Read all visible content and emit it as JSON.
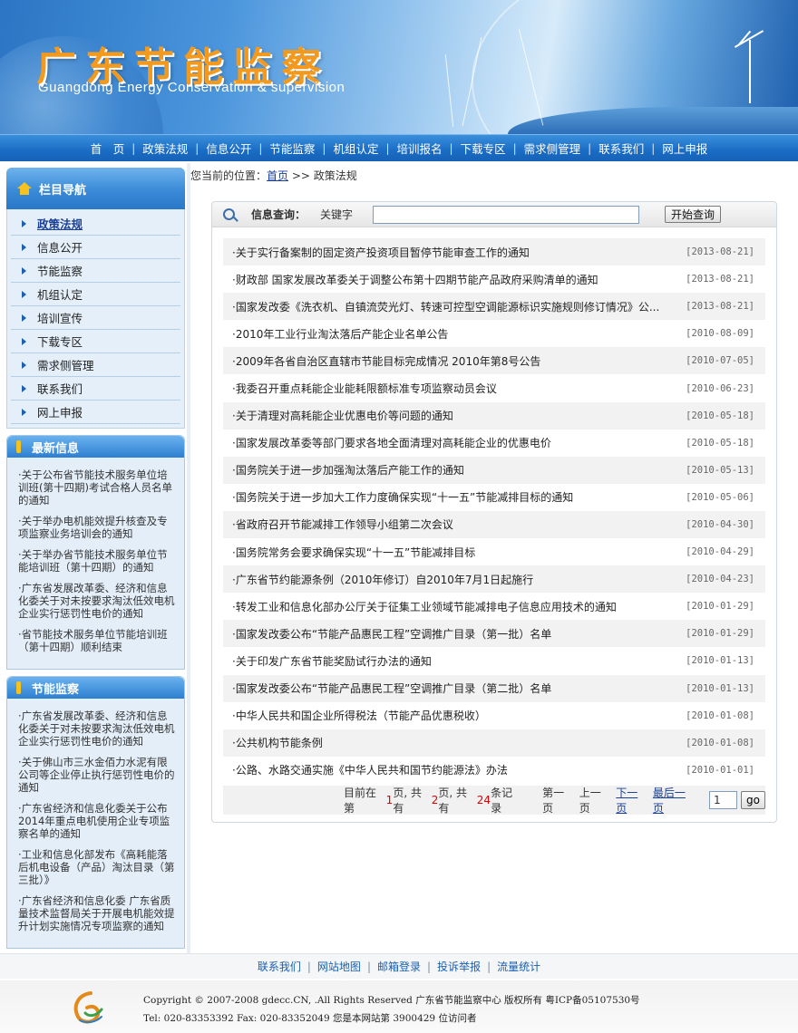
{
  "banner": {
    "title": "广东节能监察",
    "subtitle": "Guangdong Energy Conservation & supervision"
  },
  "nav": {
    "items": [
      "首　页",
      "政策法规",
      "信息公开",
      "节能监察",
      "机组认定",
      "培训报名",
      "下载专区",
      "需求侧管理",
      "联系我们",
      "网上申报"
    ]
  },
  "sidebar": {
    "title": "栏目导航",
    "items": [
      "政策法规",
      "信息公开",
      "节能监察",
      "机组认定",
      "培训宣传",
      "下载专区",
      "需求侧管理",
      "联系我们",
      "网上申报"
    ],
    "latest": {
      "title": "最新信息",
      "items": [
        "·关于公布省节能技术服务单位培训班(第十四期)考试合格人员名单的通知",
        "·关于举办电机能效提升核查及专项监察业务培训会的通知",
        "·关于举办省节能技术服务单位节能培训班（第十四期）的通知",
        "·广东省发展改革委、经济和信息化委关于对未按要求淘汰低效电机企业实行惩罚性电价的通知",
        "·省节能技术服务单位节能培训班（第十四期）顺利结束"
      ]
    },
    "supervision": {
      "title": "节能监察",
      "items": [
        "·广东省发展改革委、经济和信息化委关于对未按要求淘汰低效电机企业实行惩罚性电价的通知",
        "·关于佛山市三水金佰力水泥有限公司等企业停止执行惩罚性电价的通知",
        "·广东省经济和信息化委关于公布2014年重点电机使用企业专项监察名单的通知",
        "·工业和信息化部发布《高耗能落后机电设备（产品）淘汰目录（第三批）》",
        "·广东省经济和信息化委 广东省质量技术监督局关于开展电机能效提升计划实施情况专项监察的通知"
      ]
    }
  },
  "breadcrumb": {
    "prefix": "您当前的位置：",
    "home": "首页",
    "sep": ">>",
    "current": "政策法规"
  },
  "search": {
    "label": "信息查询：",
    "keyword_label": "关键字",
    "value": "",
    "button": "开始查询"
  },
  "articles": [
    {
      "title": "·关于实行备案制的固定资产投资项目暂停节能审查工作的通知",
      "date": "[2013-08-21]"
    },
    {
      "title": "·财政部 国家发展改革委关于调整公布第十四期节能产品政府采购清单的通知",
      "date": "[2013-08-21]"
    },
    {
      "title": "·国家发改委《洗衣机、自镇流荧光灯、转速可控型空调能源标识实施规则修订情况》公...",
      "date": "[2013-08-21]"
    },
    {
      "title": "·2010年工业行业淘汰落后产能企业名单公告",
      "date": "[2010-08-09]"
    },
    {
      "title": "·2009年各省自治区直辖市节能目标完成情况 2010年第8号公告",
      "date": "[2010-07-05]"
    },
    {
      "title": "·我委召开重点耗能企业能耗限额标准专项监察动员会议",
      "date": "[2010-06-23]"
    },
    {
      "title": "·关于清理对高耗能企业优惠电价等问题的通知",
      "date": "[2010-05-18]"
    },
    {
      "title": "·国家发展改革委等部门要求各地全面清理对高耗能企业的优惠电价",
      "date": "[2010-05-18]"
    },
    {
      "title": "·国务院关于进一步加强淘汰落后产能工作的通知",
      "date": "[2010-05-13]"
    },
    {
      "title": "·国务院关于进一步加大工作力度确保实现“十一五”节能减排目标的通知",
      "date": "[2010-05-06]"
    },
    {
      "title": "·省政府召开节能减排工作领导小组第二次会议",
      "date": "[2010-04-30]"
    },
    {
      "title": "·国务院常务会要求确保实现“十一五”节能减排目标",
      "date": "[2010-04-29]"
    },
    {
      "title": "·广东省节约能源条例（2010年修订）自2010年7月1日起施行",
      "date": "[2010-04-23]"
    },
    {
      "title": "·转发工业和信息化部办公厅关于征集工业领域节能减排电子信息应用技术的通知",
      "date": "[2010-01-29]"
    },
    {
      "title": "·国家发改委公布“节能产品惠民工程”空调推广目录（第一批）名单",
      "date": "[2010-01-29]"
    },
    {
      "title": "·关于印发广东省节能奖励试行办法的通知",
      "date": "[2010-01-13]"
    },
    {
      "title": "·国家发改委公布“节能产品惠民工程”空调推广目录（第二批）名单",
      "date": "[2010-01-13]"
    },
    {
      "title": "·中华人民共和国企业所得税法（节能产品优惠税收）",
      "date": "[2010-01-08]"
    },
    {
      "title": "·公共机构节能条例",
      "date": "[2010-01-08]"
    },
    {
      "title": "·公路、水路交通实施《中华人民共和国节约能源法》办法",
      "date": "[2010-01-01]"
    }
  ],
  "pager": {
    "t1": "目前在第",
    "current": "1",
    "t2": "页, 共有",
    "total_pages": "2",
    "t3": "页, 共有",
    "total_records": "24",
    "t4": "条记录",
    "first": "第一页",
    "prev": "上一页",
    "next": "下一页",
    "last": "最后一页",
    "input_value": "1",
    "go": "go"
  },
  "footer": {
    "links": [
      "联系我们",
      "网站地图",
      "邮箱登录",
      "投诉举报",
      "流量统计"
    ],
    "copyright": "Copyright © 2007-2008 gdecc.CN, .All Rights Reserved 广东省节能监察中心 版权所有 粤ICP备05107530号",
    "contact": "Tel: 020-83353392 Fax: 020-83352049 您是本网站第 3900429 位访问者"
  },
  "colors": {
    "title_orange": "#f39a1e",
    "nav_blue": "#1a6cc4",
    "link_blue": "#1a3f95",
    "highlight_red": "#dd0000"
  }
}
